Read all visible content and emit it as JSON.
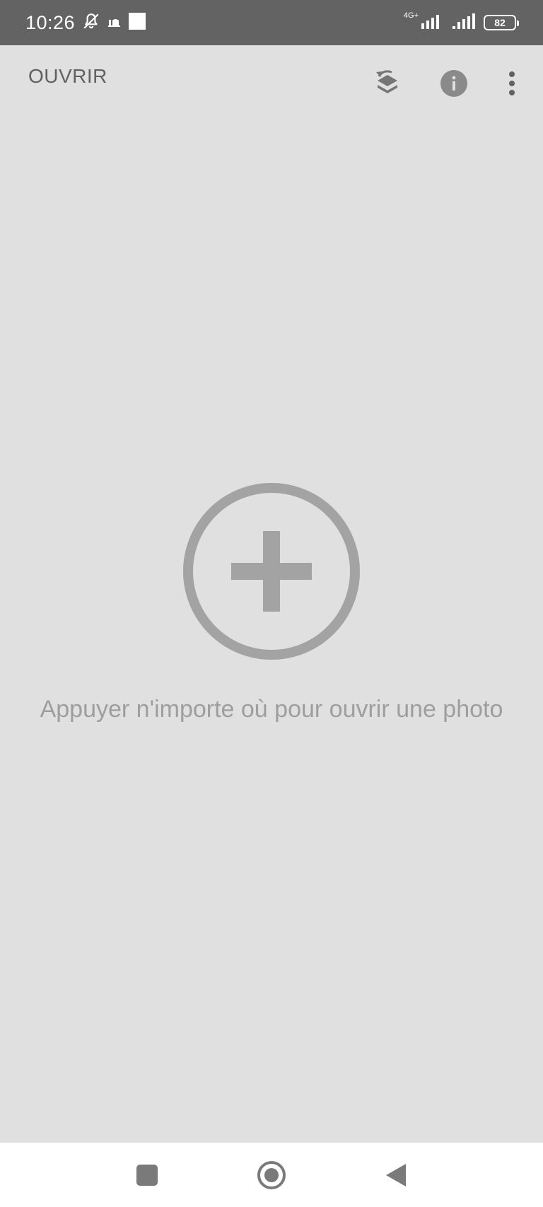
{
  "status_bar": {
    "time": "10:26",
    "network_type": "4G+",
    "battery_level": "82",
    "icons": [
      "bell-off-icon",
      "notification-app-icon",
      "white-square-icon",
      "signal-icon",
      "signal-icon",
      "battery-icon"
    ]
  },
  "app_bar": {
    "open_label": "OUVRIR",
    "actions": [
      "layers-revert-icon",
      "info-icon",
      "more-vert-icon"
    ]
  },
  "main": {
    "add_icon": "add-circle-icon",
    "hint": "Appuyer n'importe où pour ouvrir une photo"
  },
  "nav_bar": {
    "buttons": [
      "recent-apps-icon",
      "home-icon",
      "back-icon"
    ]
  },
  "colors": {
    "background": "#e0e0e0",
    "status_bar": "#636363",
    "icon_gray": "#9e9e9e",
    "dark_icon": "#616161"
  }
}
